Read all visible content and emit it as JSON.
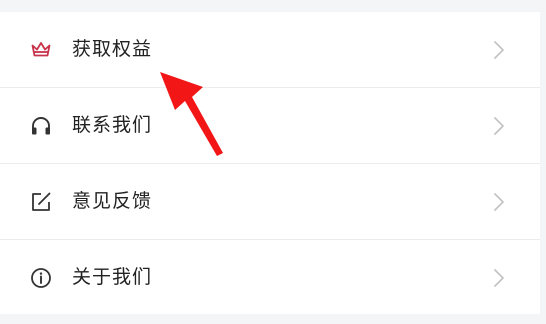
{
  "menu": {
    "items": [
      {
        "label": "获取权益",
        "icon": "crown-icon"
      },
      {
        "label": "联系我们",
        "icon": "headphones-icon"
      },
      {
        "label": "意见反馈",
        "icon": "edit-icon"
      },
      {
        "label": "关于我们",
        "icon": "info-icon"
      }
    ]
  },
  "colors": {
    "crown_icon": "#c8324b",
    "icon": "#333333",
    "chevron": "#c4c4c4",
    "arrow": "#f21616",
    "background": "#f4f5f7"
  }
}
